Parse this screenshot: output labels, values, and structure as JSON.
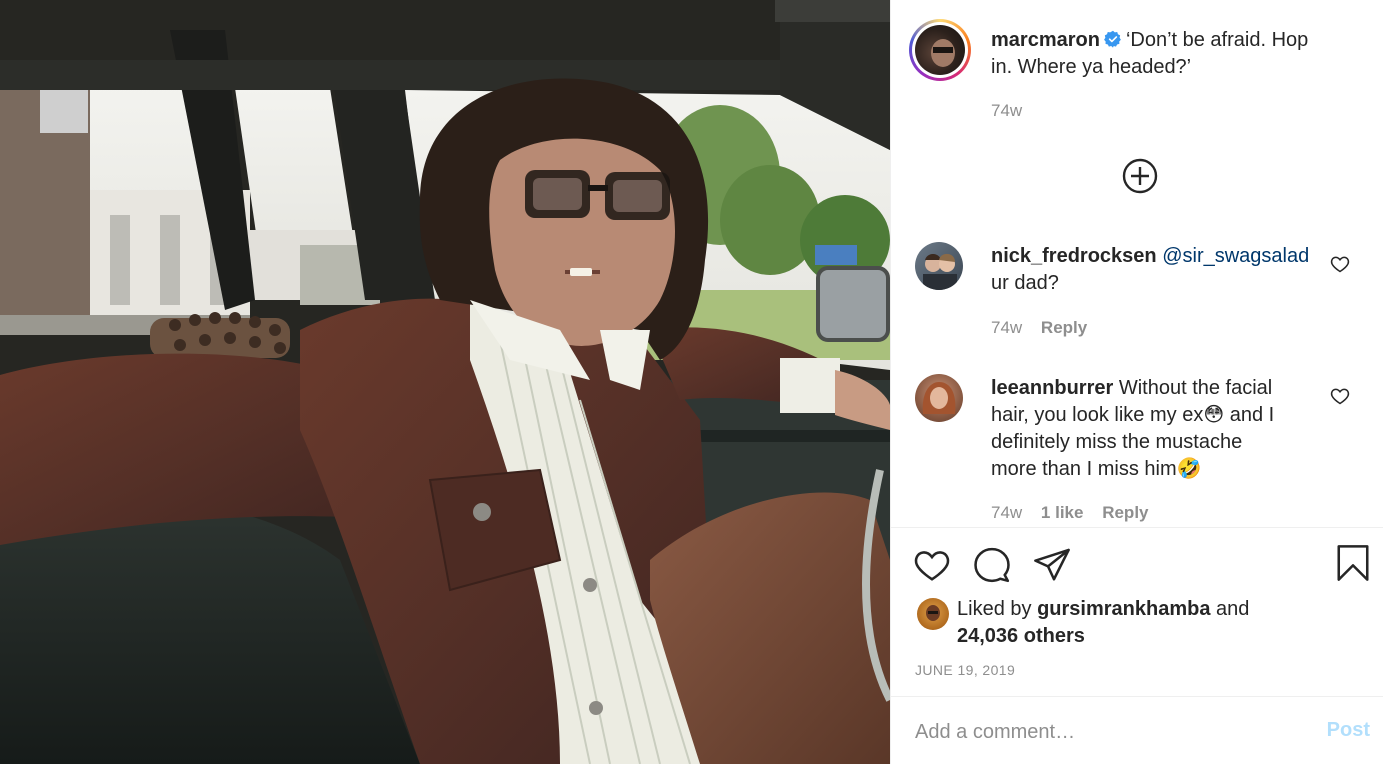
{
  "post": {
    "owner": {
      "username": "marcmaron",
      "verified": true,
      "avatar_icon": "profile-avatar"
    },
    "caption": {
      "line1": "‘Don’t be afraid. Hop",
      "line2": "in. Where ya headed?’",
      "age": "74w"
    },
    "load_more_icon": "plus-circle-icon",
    "comments": [
      {
        "username": "nick_fredrocksen",
        "mention": "@sir_swagsalad",
        "text": "ur dad?",
        "age": "74w",
        "likes": "",
        "reply_label": "Reply"
      },
      {
        "username": "leeannburrer",
        "lines": [
          "Without the facial",
          "hair, you look like my ex😳 and I",
          "definitely miss the mustache",
          "more than I miss him🤣"
        ],
        "age": "74w",
        "likes": "1 like",
        "reply_label": "Reply"
      }
    ],
    "likes": {
      "prefix": "Liked by",
      "user": "gursimrankhamba",
      "and": "and",
      "others": "24,036 others"
    },
    "date": "JUNE 19, 2019",
    "comment_box": {
      "placeholder": "Add a comment…",
      "post_label": "Post"
    },
    "colors": {
      "accent": "#0095f6",
      "post_disabled": "#b2dffc",
      "secondary_text": "#8e8e8e",
      "mention": "#00376b"
    }
  }
}
